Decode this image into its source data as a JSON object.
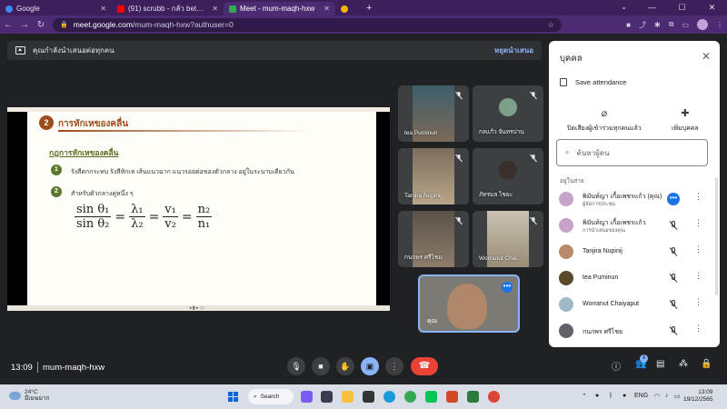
{
  "browser": {
    "tabs": [
      {
        "label": "Google",
        "color": "#4285f4"
      },
      {
        "label": "(91) scrubb - กลัว between (18th)",
        "color": "#ff0000"
      },
      {
        "label": "Meet - mum-maqh-hxw",
        "color": "#34a853"
      },
      {
        "label": "",
        "color": "#f4b400"
      }
    ],
    "new_tab": "+",
    "tab_search": "⌄",
    "window_controls": [
      "—",
      "☐",
      "✕"
    ],
    "url": {
      "host": "meet.google.com",
      "path": "/mum-maqh-hxw?authuser=0"
    },
    "nav": {
      "back": "←",
      "forward": "→",
      "reload": "↻"
    }
  },
  "banner": {
    "text": "คุณกำลังนำเสนอต่อทุกคน",
    "stop_label": "หยุดนำเสนอ"
  },
  "slide": {
    "number": "2",
    "title": "การหักเหของคลื่น",
    "subtitle": "กฎการหักเหของคลื่น",
    "bullets": [
      {
        "num": "1",
        "text": "รังสีตกกระทบ รังสีหักเห เส้นแนวฉาก แนวรอยต่อของตัวกลาง อยู่ในระนาบเดียวกัน"
      },
      {
        "num": "2",
        "text": "สำหรับตัวกลางคู่หนึ่ง ๆ"
      }
    ],
    "formula": [
      {
        "num": "sin θ₁",
        "den": "sin θ₂"
      },
      {
        "num": "λ₁",
        "den": "λ₂"
      },
      {
        "num": "v₁",
        "den": "v₂"
      },
      {
        "num": "n₂",
        "den": "n₁"
      }
    ],
    "equals": "="
  },
  "participants_grid": [
    {
      "name": "tea Puminun",
      "bg": "#4a6a7a"
    },
    {
      "name": "กลแก้ว จันทรปาน",
      "bg": "#3c4043"
    },
    {
      "name": "Tanjira Nupinij",
      "bg": "#6a5a48"
    },
    {
      "name": "ภัทรมล ไชยะ",
      "bg": "#3c4043"
    },
    {
      "name": "กนกพร ศรีไชย",
      "bg": "#5c5a55"
    },
    {
      "name": "Worranut Chai...",
      "bg": "#8a8578"
    }
  ],
  "self_tile": {
    "name": "คุณ",
    "more": "•••"
  },
  "panel": {
    "title": "บุคคล",
    "close": "✕",
    "save_attendance": "Save attendance",
    "mute_all": "ปิดเสียงผู้เข้าร่วมทุกคนแล้ว",
    "add_people": "เพิ่มบุคคล",
    "search_placeholder": "ค้นหาผู้คน",
    "section": "อยู่ในสาย",
    "people": [
      {
        "name": "พิมันท์ญา เกื้อเพชรแก้ว (คุณ)",
        "sub": "ผู้จัดการประชุม",
        "state": "speaking",
        "avatar": "#c7a3c9"
      },
      {
        "name": "พิมันท์ญา เกื้อเพชรแก้ว",
        "sub": "การนำเสนอของคุณ",
        "state": "muted",
        "avatar": "#c7a3c9"
      },
      {
        "name": "Tanjira Nupinij",
        "sub": "",
        "state": "muted",
        "avatar": "#b88a6a"
      },
      {
        "name": "tea Puminun",
        "sub": "",
        "state": "muted",
        "avatar": "#5b4a2a"
      },
      {
        "name": "Worranut Chaiyaput",
        "sub": "",
        "state": "muted",
        "avatar": "#9fb8c8"
      },
      {
        "name": "กนกพร ศรีไชย",
        "sub": "",
        "state": "muted",
        "avatar": "#5f6368"
      }
    ]
  },
  "bottom": {
    "time": "13:09",
    "meeting_code": "mum-maqh-hxw",
    "participant_count": "8"
  },
  "taskbar": {
    "temp": "24°C",
    "weather": "มีเมฆมาก",
    "search": "Search",
    "lang": "ENG",
    "time": "13:09",
    "date": "19/12/2565"
  },
  "colors": {
    "accent": "#8ab4f8",
    "end_call": "#ea4335",
    "meet_bg": "#202124",
    "slide_title": "#9c4d1c"
  }
}
